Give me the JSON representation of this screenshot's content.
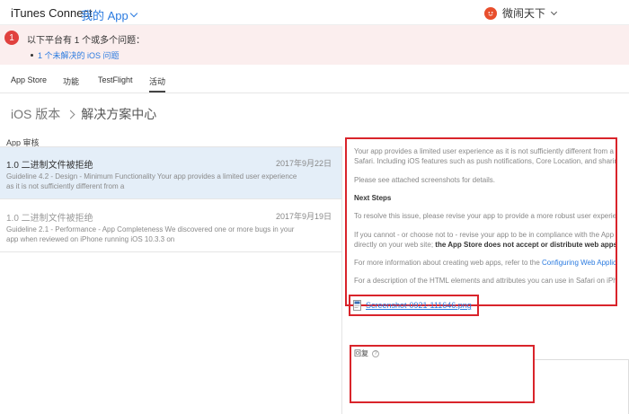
{
  "header": {
    "brand": "iTunes Connect",
    "app_menu": "我的 App",
    "user_name": "微闹天下"
  },
  "alert": {
    "badge": "1",
    "title": "以下平台有 1 个或多个问题：",
    "item": "1 个未解决的 iOS 问题"
  },
  "tabs": [
    {
      "label": "App Store"
    },
    {
      "label": "功能"
    },
    {
      "label": "TestFlight"
    },
    {
      "label": "活动"
    }
  ],
  "breadcrumb": {
    "parent": "iOS 版本",
    "current": "解决方案中心"
  },
  "section_label": "App 审核",
  "issues": [
    {
      "title": "1.0 二进制文件被拒绝",
      "date": "2017年9月22日",
      "desc_line1": "Guideline 4.2 - Design - Minimum Functionality Your app provides a limited user experience",
      "desc_line2": "as it is not sufficiently different from a"
    },
    {
      "title": "1.0 二进制文件被拒绝",
      "date": "2017年9月19日",
      "desc_line1": "Guideline 2.1 - Performance - App Completeness We discovered one or more bugs in your",
      "desc_line2": "app when reviewed on iPhone running iOS 10.3.3 on"
    }
  ],
  "message": {
    "line1": "Your app provides a limited user experience as it is not sufficiently different from a",
    "line2": "Safari. Including iOS features such as push notifications, Core Location, and sharing",
    "line3": "Please see attached screenshots for details.",
    "next_steps": "Next Steps",
    "line4": "To resolve this issue, please revise your app to provide a more robust user experien",
    "line5": "If you cannot - or choose not to - revise your app to be in compliance with the App",
    "line6_a": "directly on your web site;",
    "line6_b": "the App Store does not accept or distribute web apps.",
    "line7_a": "For more information about creating web apps, refer to the",
    "line7_link": "Configuring Web Applic",
    "line8": "For a description of the HTML elements and attributes you can use in Safari on iPh"
  },
  "attachment": {
    "filename": "Screenshot-0921-111646.png"
  },
  "reply": {
    "label": "回复",
    "help": "?",
    "value": ""
  },
  "colors": {
    "accent": "#2b7be0",
    "alert_bg": "#fbeeee",
    "badge": "#e0413e",
    "selected_row": "#e4eef8",
    "highlight_box": "#d9242b"
  }
}
